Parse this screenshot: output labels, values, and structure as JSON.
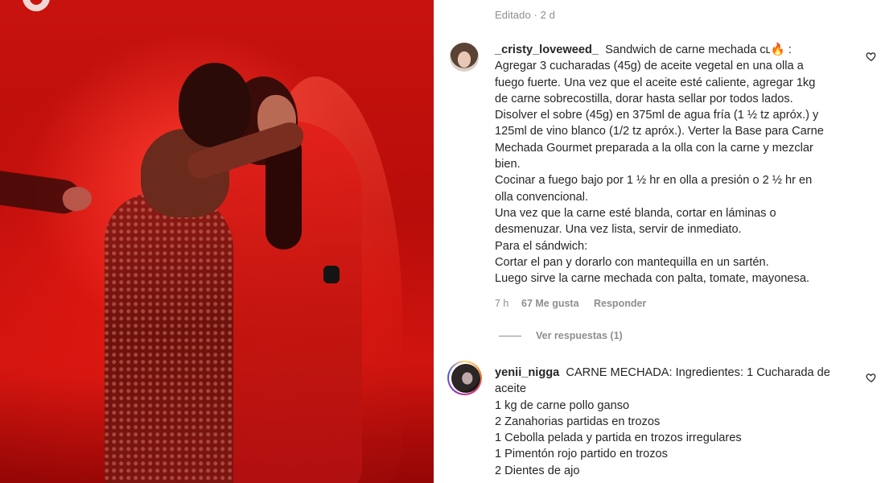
{
  "post": {
    "edited_label": "Editado · 2 d"
  },
  "comments": [
    {
      "username": "_cristy_loveweed_",
      "lines": [
        "Sandwich de carne mechada cʟ🔥 :",
        "Agregar 3 cucharadas (45g) de aceite vegetal en una olla a",
        "fuego fuerte. Una vez que el aceite esté caliente, agregar 1kg",
        "de carne sobrecostilla, dorar hasta sellar por todos lados.",
        "Disolver el sobre (45g) en 375ml de agua fría (1 ½ tz apróx.) y",
        "125ml de vino blanco (1/2 tz apróx.). Verter la Base para Carne",
        "Mechada Gourmet preparada a la olla con la carne y mezclar",
        "bien.",
        "Cocinar a fuego bajo por 1 ½ hr en olla a presión o 2 ½ hr en",
        "olla convencional.",
        "Una vez que la carne esté blanda, cortar en láminas o",
        "desmenuzar. Una vez lista, servir de inmediato.",
        "Para el sándwich:",
        "Cortar el pan y dorarlo con mantequilla en un sartén.",
        "Luego sirve la carne mechada con palta, tomate, mayonesa."
      ],
      "time": "7 h",
      "likes": "67 Me gusta",
      "reply_label": "Responder",
      "view_replies": "Ver respuestas (1)"
    },
    {
      "username": "yenii_nigga",
      "lines": [
        "CARNE MECHADA: Ingredientes: 1 Cucharada de",
        "aceite",
        "1 kg de carne pollo ganso",
        "2 Zanahorias partidas en trozos",
        "1 Cebolla pelada y partida en trozos irregulares",
        "1 Pimentón rojo partido en trozos",
        "2 Dientes de ajo"
      ]
    }
  ],
  "icons": {
    "heart": "heart-outline-icon",
    "logo": "award-logo-icon"
  },
  "colors": {
    "stage_red": "#c8120e",
    "text": "#262626",
    "muted": "#8e8e8e"
  }
}
